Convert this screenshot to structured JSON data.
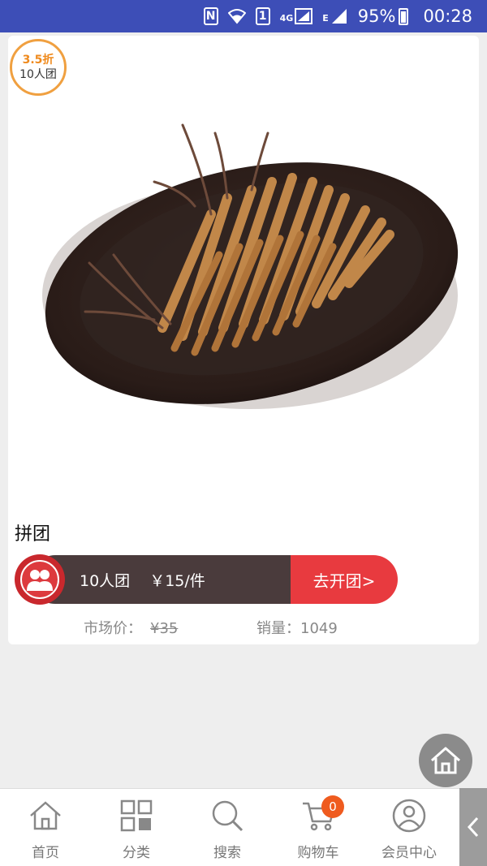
{
  "status_bar": {
    "nfc": "N",
    "sim1": "1",
    "network_4g": "4G",
    "network_e": "E",
    "battery": "95%",
    "time": "00:28"
  },
  "product": {
    "badge_discount": "3.5折",
    "badge_group": "10人团",
    "section_title": "拼团",
    "group_size": "10人团",
    "group_price": "￥15/件",
    "open_group_label": "去开团>",
    "market_price_label": "市场价：",
    "market_price": "¥35",
    "sales_label": "销量：1049"
  },
  "tabbar": {
    "items": [
      {
        "label": "首页",
        "icon": "home-icon"
      },
      {
        "label": "分类",
        "icon": "category-grid-icon"
      },
      {
        "label": "搜索",
        "icon": "search-icon"
      },
      {
        "label": "购物车",
        "icon": "cart-icon"
      },
      {
        "label": "会员中心",
        "icon": "user-icon"
      }
    ],
    "cart_count": "0"
  },
  "colors": {
    "status_bar": "#3d4eb7",
    "group_bar_dark": "#4a3b3c",
    "open_group_button": "#e83a3f",
    "badge_orange": "#ef8a1d",
    "cart_badge": "#ef5b1f"
  }
}
